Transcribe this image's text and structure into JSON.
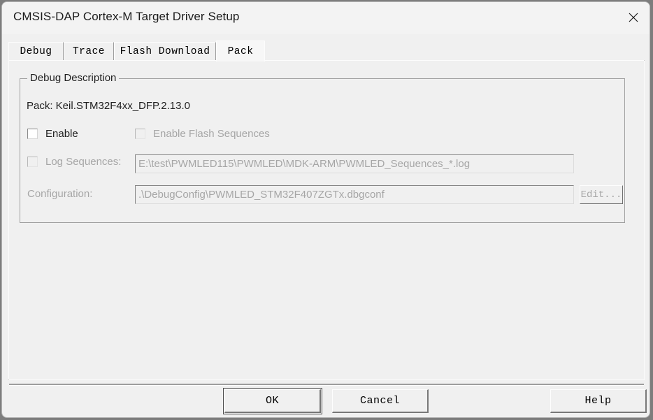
{
  "window": {
    "title": "CMSIS-DAP Cortex-M Target Driver Setup",
    "close_icon": "close-icon"
  },
  "tabs": [
    {
      "label": "Debug",
      "selected": false
    },
    {
      "label": "Trace",
      "selected": false
    },
    {
      "label": "Flash Download",
      "selected": false
    },
    {
      "label": "Pack",
      "selected": true
    }
  ],
  "debug_description": {
    "group_title": "Debug Description",
    "pack_line": "Pack: Keil.STM32F4xx_DFP.2.13.0",
    "enable_checkbox": {
      "label": "Enable",
      "checked": false,
      "enabled": true
    },
    "enable_flash_sequences_checkbox": {
      "label": "Enable Flash Sequences",
      "checked": false,
      "enabled": false
    },
    "log_sequences_checkbox": {
      "label": "Log Sequences:",
      "checked": false,
      "enabled": false
    },
    "log_sequences_field": {
      "value": "E:\\test\\PWMLED115\\PWMLED\\MDK-ARM\\PWMLED_Sequences_*.log",
      "enabled": false
    },
    "configuration_label": "Configuration:",
    "configuration_field": {
      "value": ".\\DebugConfig\\PWMLED_STM32F407ZGTx.dbgconf",
      "enabled": false
    },
    "edit_button": {
      "label": "Edit...",
      "enabled": false
    }
  },
  "footer": {
    "ok_label": "OK",
    "cancel_label": "Cancel",
    "help_label": "Help"
  },
  "colors": {
    "dialog_face": "#f0f0f0",
    "titlebar": "#f3f3f3",
    "text": "#1f1f1f",
    "disabled_text": "#a6a6a6",
    "border": "#a0a0a0"
  }
}
